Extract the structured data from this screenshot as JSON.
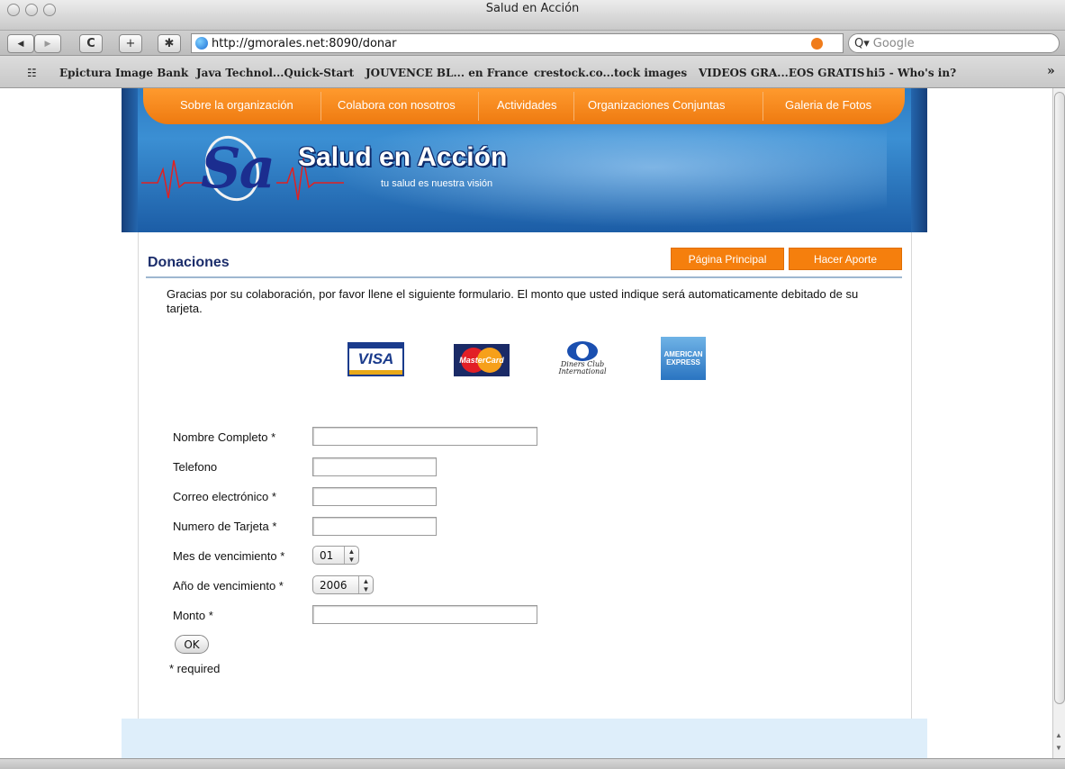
{
  "window": {
    "title": "Salud en Acción"
  },
  "toolbar": {
    "back_label": "◀",
    "forward_label": "▶",
    "reload_label": "C",
    "add_label": "+",
    "bug_label": "✱",
    "url": "http://gmorales.net:8090/donar",
    "search_placeholder": "Google",
    "search_glyph": "Q▾"
  },
  "bookmarks": {
    "items": [
      "Epictura Image Bank",
      "Java Technol...Quick-Start",
      "JOUVENCE BL... en France",
      "crestock.co...tock images",
      "VIDEOS GRA...EOS GRATIS",
      "hi5 - Who's in?"
    ],
    "overflow": "»"
  },
  "site": {
    "nav": [
      "Sobre la organización",
      "Colabora con nosotros",
      "Actividades",
      "Organizaciones Conjuntas",
      "Galeria de Fotos"
    ],
    "logo_text": "Sa",
    "brand": "Salud en Acción",
    "tagline": "tu salud es nuestra visión",
    "colors": {
      "nav_orange": "#f58a1f",
      "banner_blue": "#2f7fc8",
      "title_navy": "#1b2d6b",
      "button_orange": "#f57f0d"
    }
  },
  "page": {
    "title": "Donaciones",
    "home_button": "Página Principal",
    "donate_button": "Hacer Aporte",
    "intro": "Gracias por su colaboración, por favor llene el siguiente formulario. El monto que usted indique será automaticamente debitado de su tarjeta.",
    "cards": {
      "visa": "VISA",
      "mastercard": "MasterCard",
      "diners": "Diners Club International",
      "amex": "AMERICAN EXPRESS"
    }
  },
  "form": {
    "fields": {
      "name": "Nombre Completo *",
      "phone": "Telefono",
      "email": "Correo electrónico *",
      "card_number": "Numero de Tarjeta *",
      "exp_month": "Mes de vencimiento *",
      "exp_year": "Año de vencimiento *",
      "amount": "Monto *"
    },
    "values": {
      "name": "",
      "phone": "",
      "email": "",
      "card_number": "",
      "exp_month": "01",
      "exp_year": "2006",
      "amount": ""
    },
    "submit_label": "OK",
    "required_note": "* required"
  }
}
